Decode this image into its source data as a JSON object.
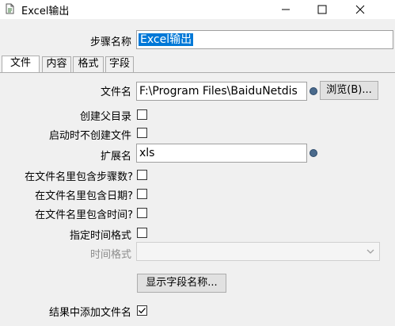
{
  "window": {
    "title": "Excel输出"
  },
  "step_name": {
    "label": "步骤名称",
    "value": "Excel输出"
  },
  "tabs": [
    {
      "label": "文件"
    },
    {
      "label": "内容"
    },
    {
      "label": "格式"
    },
    {
      "label": "字段"
    }
  ],
  "file": {
    "filename_label": "文件名",
    "filename_value": "F:\\Program Files\\BaiduNetdis",
    "browse_label": "浏览(B)...",
    "create_parent_label": "创建父目录",
    "create_parent_checked": false,
    "no_create_on_start_label": "启动时不创建文件",
    "no_create_on_start_checked": false,
    "extension_label": "扩展名",
    "extension_value": "xls",
    "include_step_label": "在文件名里包含步骤数?",
    "include_step_checked": false,
    "include_date_label": "在文件名里包含日期?",
    "include_date_checked": false,
    "include_time_label": "在文件名里包含时间?",
    "include_time_checked": false,
    "specify_time_format_label": "指定时间格式",
    "specify_time_format_checked": false,
    "time_format_label": "时间格式",
    "time_format_value": "",
    "show_fields_label": "显示字段名称...",
    "add_filename_label": "结果中添加文件名",
    "add_filename_checked": true
  }
}
